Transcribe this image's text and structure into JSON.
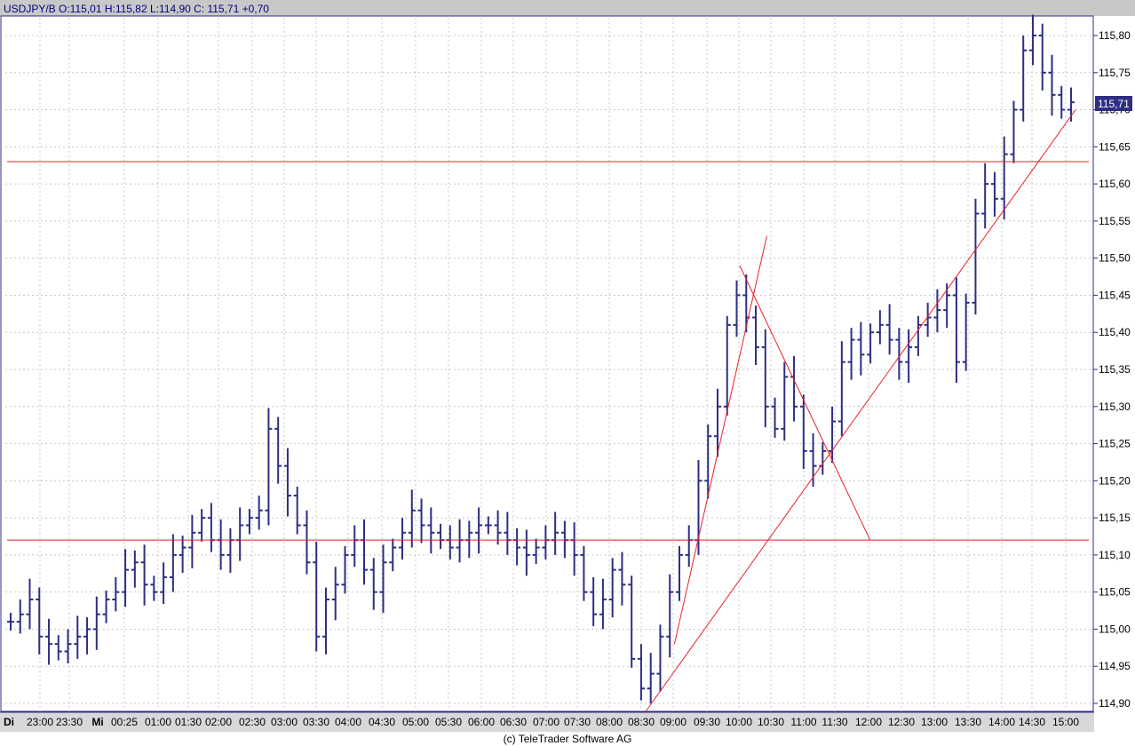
{
  "header": {
    "title": "USDJPY/B O:115,01 H:115,82 L:114,90 C: 115,71 +0,70"
  },
  "footer": {
    "copyright": "(c) TeleTrader Software AG"
  },
  "last_price_label": "115,71",
  "colors": {
    "background": "#ffffff",
    "header_bar": "#c8c8c8",
    "bars": "#2e2e82",
    "lines": "#e8202a",
    "grid": "#c8c8c8",
    "last_box": "#2e2e82"
  },
  "chart_data": {
    "type": "ohlc",
    "symbol": "USDJPY/B",
    "open": 115.01,
    "high": 115.82,
    "low": 114.9,
    "close": 115.71,
    "change": 0.7,
    "ylim": [
      114.89,
      115.85
    ],
    "y_ticks": [
      "114,90",
      "114,95",
      "115,00",
      "115,05",
      "115,10",
      "115,15",
      "115,20",
      "115,25",
      "115,30",
      "115,35",
      "115,40",
      "115,45",
      "115,50",
      "115,55",
      "115,60",
      "115,65",
      "115,70",
      "115,75",
      "115,80"
    ],
    "y_tick_values": [
      114.9,
      114.95,
      115.0,
      115.05,
      115.1,
      115.15,
      115.2,
      115.25,
      115.3,
      115.35,
      115.4,
      115.45,
      115.5,
      115.55,
      115.6,
      115.65,
      115.7,
      115.75,
      115.8
    ],
    "x_labels": [
      "Di",
      "23:00",
      "23:30",
      "Mi",
      "00:25",
      "01:00",
      "01:30",
      "02:00",
      "02:30",
      "03:00",
      "03:30",
      "04:00",
      "04:30",
      "05:00",
      "05:30",
      "06:00",
      "06:30",
      "07:00",
      "07:30",
      "08:00",
      "08:30",
      "09:00",
      "09:30",
      "10:00",
      "10:30",
      "11:00",
      "11:30",
      "12:00",
      "12:30",
      "13:00",
      "13:30",
      "14:00",
      "14:30",
      "15:00"
    ],
    "x_label_bold": [
      "Di",
      "Mi"
    ],
    "grid": true,
    "close_path": [
      115.01,
      115.02,
      115.04,
      114.99,
      114.98,
      114.97,
      114.98,
      114.99,
      115.0,
      115.02,
      115.04,
      115.05,
      115.08,
      115.09,
      115.06,
      115.05,
      115.07,
      115.1,
      115.11,
      115.13,
      115.15,
      115.12,
      115.1,
      115.12,
      115.14,
      115.15,
      115.16,
      115.27,
      115.22,
      115.18,
      115.14,
      115.09,
      114.99,
      115.04,
      115.06,
      115.1,
      115.12,
      115.08,
      115.05,
      115.09,
      115.11,
      115.13,
      115.16,
      115.14,
      115.13,
      115.12,
      115.11,
      115.12,
      115.13,
      115.14,
      115.14,
      115.13,
      115.12,
      115.11,
      115.1,
      115.11,
      115.12,
      115.13,
      115.12,
      115.1,
      115.05,
      115.02,
      115.04,
      115.08,
      115.06,
      114.96,
      114.92,
      114.94,
      114.99,
      115.05,
      115.1,
      115.12,
      115.2,
      115.26,
      115.3,
      115.41,
      115.45,
      115.42,
      115.38,
      115.3,
      115.27,
      115.34,
      115.3,
      115.24,
      115.22,
      115.24,
      115.28,
      115.36,
      115.39,
      115.37,
      115.4,
      115.41,
      115.39,
      115.36,
      115.38,
      115.41,
      115.42,
      115.43,
      115.45,
      115.36,
      115.44,
      115.56,
      115.6,
      115.58,
      115.64,
      115.7,
      115.78,
      115.8,
      115.75,
      115.72,
      115.7,
      115.71
    ],
    "reference_lines": [
      {
        "kind": "horizontal",
        "y": 115.63
      },
      {
        "kind": "horizontal",
        "y": 115.12
      }
    ],
    "trend_lines": [
      {
        "time": [
          "08:34",
          "15:09"
        ],
        "y": [
          114.89,
          115.7
        ]
      },
      {
        "time": [
          "09:00",
          "10:25"
        ],
        "y": [
          114.98,
          115.53
        ]
      },
      {
        "time": [
          "10:00",
          "12:00"
        ],
        "y": [
          115.49,
          115.12
        ]
      }
    ]
  }
}
